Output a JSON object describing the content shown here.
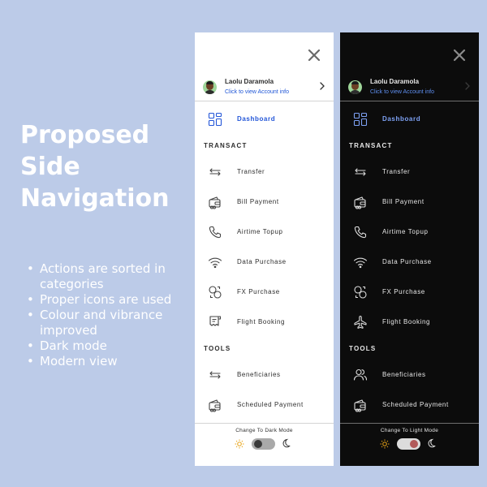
{
  "headline": [
    "Proposed",
    "Side",
    "Navigation"
  ],
  "bullets": [
    [
      "Actions are sorted in",
      "categories"
    ],
    [
      "Proper icons are used"
    ],
    [
      "Colour and vibrance",
      "improved"
    ],
    [
      "Dark mode"
    ],
    [
      "Modern view"
    ]
  ],
  "profile": {
    "name": "Laolu Daramola",
    "link": "Click to view Account info"
  },
  "nav": {
    "dashboard": "Dashboard",
    "section_transact": "TRANSACT",
    "transfer": "Transfer",
    "bill_payment": "Bill Payment",
    "airtime_topup": "Airtime Topup",
    "data_purchase": "Data Purchase",
    "fx_purchase": "FX Purchase",
    "flight_booking": "Flight Booking",
    "section_tools": "TOOLS",
    "beneficiaries": "Beneficiaries",
    "scheduled_payment": "Scheduled Payment"
  },
  "light_panel": {
    "mode_label": "Change To Dark Mode"
  },
  "dark_panel": {
    "mode_label": "Change To Light Mode"
  },
  "colors": {
    "background": "#bccbe8",
    "accent": "#2356d8",
    "sun": "#e8a317"
  }
}
